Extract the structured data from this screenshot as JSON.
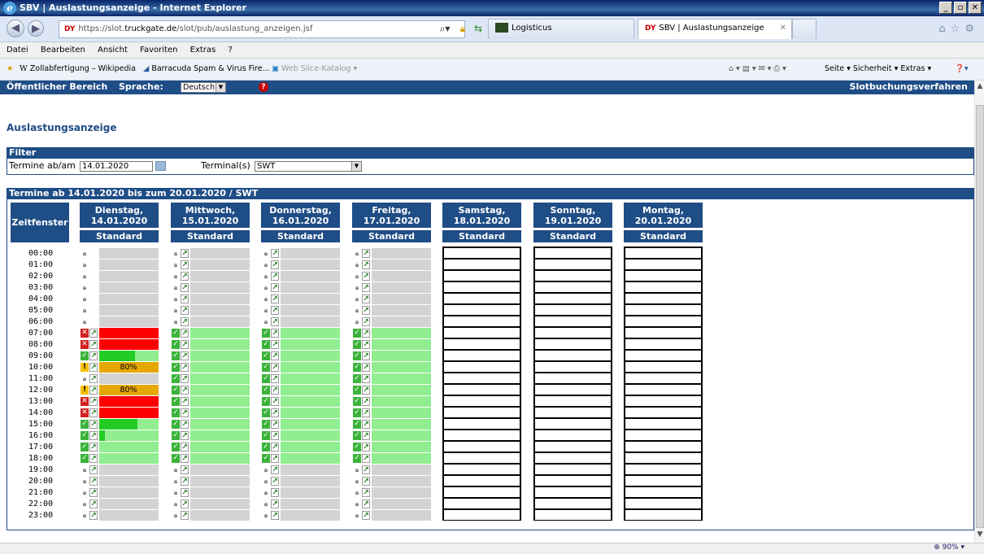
{
  "browser": {
    "window_title": "SBV | Auslastungsanzeige - Internet Explorer",
    "url_prefix": "https://slot.",
    "url_host": "truckgate.de",
    "url_path": "/slot/pub/auslastung_anzeigen.jsf",
    "tabs": [
      {
        "label": "Logisticus",
        "active": false
      },
      {
        "label": "SBV | Auslastungsanzeige",
        "active": true
      }
    ],
    "menu": [
      "Datei",
      "Bearbeiten",
      "Ansicht",
      "Favoriten",
      "Extras",
      "?"
    ],
    "favorites": [
      "Zollabfertigung – Wikipedia",
      "Barracuda Spam & Virus Fire...",
      "Web Slice-Katalog ▾"
    ],
    "command_bar": "Seite ▾   Sicherheit ▾   Extras ▾",
    "zoom": "90%"
  },
  "app_header": {
    "area": "Öffentlicher Bereich",
    "language_label": "Sprache:",
    "language_value": "Deutsch",
    "title_right": "Slotbuchungsverfahren"
  },
  "page_title": "Auslastungsanzeige",
  "filter": {
    "header": "Filter",
    "date_label": "Termine ab/am",
    "date_value": "14.01.2020",
    "terminal_label": "Terminal(s)",
    "terminal_value": "SWT"
  },
  "schedule": {
    "header": "Termine ab 14.01.2020 bis zum 20.01.2020 / SWT",
    "zeitfenster_label": "Zeitfenster",
    "standard_label": "Standard",
    "times": [
      "00:00",
      "01:00",
      "02:00",
      "03:00",
      "04:00",
      "05:00",
      "06:00",
      "07:00",
      "08:00",
      "09:00",
      "10:00",
      "11:00",
      "12:00",
      "13:00",
      "14:00",
      "15:00",
      "16:00",
      "17:00",
      "18:00",
      "19:00",
      "20:00",
      "21:00",
      "22:00",
      "23:00"
    ],
    "days": [
      {
        "name": "Dienstag,",
        "date": "14.01.2020",
        "empty": false,
        "slots": [
          {
            "s": "lock"
          },
          {
            "s": "lock"
          },
          {
            "s": "lock"
          },
          {
            "s": "lock"
          },
          {
            "s": "lock"
          },
          {
            "s": "lock"
          },
          {
            "s": "lock"
          },
          {
            "s": "full"
          },
          {
            "s": "full"
          },
          {
            "s": "open",
            "fill": 0.6
          },
          {
            "s": "warn",
            "pct": "80%"
          },
          {
            "s": "closed"
          },
          {
            "s": "warn",
            "pct": "80%"
          },
          {
            "s": "full"
          },
          {
            "s": "full"
          },
          {
            "s": "open",
            "fill": 0.65
          },
          {
            "s": "open",
            "fill": 0.1
          },
          {
            "s": "open",
            "fill": 0
          },
          {
            "s": "open",
            "fill": 0
          },
          {
            "s": "closed"
          },
          {
            "s": "closed"
          },
          {
            "s": "closed"
          },
          {
            "s": "closed"
          },
          {
            "s": "closed"
          }
        ]
      },
      {
        "name": "Mittwoch,",
        "date": "15.01.2020",
        "empty": false,
        "slots": [
          {
            "s": "closed"
          },
          {
            "s": "closed"
          },
          {
            "s": "closed"
          },
          {
            "s": "closed"
          },
          {
            "s": "closed"
          },
          {
            "s": "closed"
          },
          {
            "s": "closed"
          },
          {
            "s": "open",
            "fill": 0
          },
          {
            "s": "open",
            "fill": 0
          },
          {
            "s": "open",
            "fill": 0
          },
          {
            "s": "open",
            "fill": 0
          },
          {
            "s": "open",
            "fill": 0
          },
          {
            "s": "open",
            "fill": 0
          },
          {
            "s": "open",
            "fill": 0
          },
          {
            "s": "open",
            "fill": 0
          },
          {
            "s": "open",
            "fill": 0
          },
          {
            "s": "open",
            "fill": 0
          },
          {
            "s": "open",
            "fill": 0
          },
          {
            "s": "open",
            "fill": 0
          },
          {
            "s": "closed"
          },
          {
            "s": "closed"
          },
          {
            "s": "closed"
          },
          {
            "s": "closed"
          },
          {
            "s": "closed"
          }
        ]
      },
      {
        "name": "Donnerstag,",
        "date": "16.01.2020",
        "empty": false,
        "slots": [
          {
            "s": "closed"
          },
          {
            "s": "closed"
          },
          {
            "s": "closed"
          },
          {
            "s": "closed"
          },
          {
            "s": "closed"
          },
          {
            "s": "closed"
          },
          {
            "s": "closed"
          },
          {
            "s": "open",
            "fill": 0
          },
          {
            "s": "open",
            "fill": 0
          },
          {
            "s": "open",
            "fill": 0
          },
          {
            "s": "open",
            "fill": 0
          },
          {
            "s": "open",
            "fill": 0
          },
          {
            "s": "open",
            "fill": 0
          },
          {
            "s": "open",
            "fill": 0
          },
          {
            "s": "open",
            "fill": 0
          },
          {
            "s": "open",
            "fill": 0
          },
          {
            "s": "open",
            "fill": 0
          },
          {
            "s": "open",
            "fill": 0
          },
          {
            "s": "open",
            "fill": 0
          },
          {
            "s": "closed"
          },
          {
            "s": "closed"
          },
          {
            "s": "closed"
          },
          {
            "s": "closed"
          },
          {
            "s": "closed"
          }
        ]
      },
      {
        "name": "Freitag,",
        "date": "17.01.2020",
        "empty": false,
        "slots": [
          {
            "s": "closed"
          },
          {
            "s": "closed"
          },
          {
            "s": "closed"
          },
          {
            "s": "closed"
          },
          {
            "s": "closed"
          },
          {
            "s": "closed"
          },
          {
            "s": "closed"
          },
          {
            "s": "open",
            "fill": 0
          },
          {
            "s": "open",
            "fill": 0
          },
          {
            "s": "open",
            "fill": 0
          },
          {
            "s": "open",
            "fill": 0
          },
          {
            "s": "open",
            "fill": 0
          },
          {
            "s": "open",
            "fill": 0
          },
          {
            "s": "open",
            "fill": 0
          },
          {
            "s": "open",
            "fill": 0
          },
          {
            "s": "open",
            "fill": 0
          },
          {
            "s": "open",
            "fill": 0
          },
          {
            "s": "open",
            "fill": 0
          },
          {
            "s": "open",
            "fill": 0
          },
          {
            "s": "closed"
          },
          {
            "s": "closed"
          },
          {
            "s": "closed"
          },
          {
            "s": "closed"
          },
          {
            "s": "closed"
          }
        ]
      },
      {
        "name": "Samstag,",
        "date": "18.01.2020",
        "empty": true,
        "slots": []
      },
      {
        "name": "Sonntag,",
        "date": "19.01.2020",
        "empty": true,
        "slots": []
      },
      {
        "name": "Montag,",
        "date": "20.01.2020",
        "empty": true,
        "slots": []
      }
    ],
    "colors": {
      "header_blue": "#1f4d86",
      "closed_gray": "#d3d3d3",
      "open_light_green": "#90ee90",
      "fill_green": "#22cc22",
      "full_red": "#ff0000",
      "warn_orange": "#e5a800"
    }
  }
}
